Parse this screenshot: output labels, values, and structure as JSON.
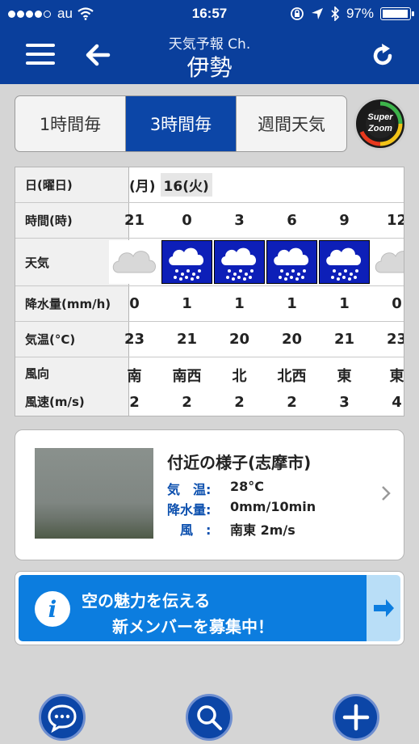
{
  "status_bar": {
    "carrier": "au",
    "time": "16:57",
    "battery": "97%",
    "battery_level": 0.97
  },
  "nav": {
    "subtitle": "天気予報 Ch.",
    "title": "伊勢"
  },
  "tabs": [
    {
      "label": "1時間毎",
      "active": false
    },
    {
      "label": "3時間毎",
      "active": true
    },
    {
      "label": "週間天気",
      "active": false
    }
  ],
  "superzoom": {
    "line1": "Super",
    "line2": "Zoom"
  },
  "forecast": {
    "labels": {
      "date": "日(曜日)",
      "time": "時間(時)",
      "weather": "天気",
      "precip": "降水量(mm/h)",
      "temp": "気温(°C)",
      "wind_dir": "風向",
      "wind_speed": "風速(m/s)"
    },
    "date_prev": "(月)",
    "date_current": "16(火)",
    "columns": [
      {
        "time": "21",
        "weather": "cloudy",
        "precip": "0",
        "temp": "23",
        "wind_dir": "南",
        "wind_speed": "2"
      },
      {
        "time": "0",
        "weather": "rain",
        "precip": "1",
        "temp": "21",
        "wind_dir": "南西",
        "wind_speed": "2"
      },
      {
        "time": "3",
        "weather": "rain",
        "precip": "1",
        "temp": "20",
        "wind_dir": "北",
        "wind_speed": "2"
      },
      {
        "time": "6",
        "weather": "rain",
        "precip": "1",
        "temp": "20",
        "wind_dir": "北西",
        "wind_speed": "2"
      },
      {
        "time": "9",
        "weather": "rain",
        "precip": "1",
        "temp": "21",
        "wind_dir": "東",
        "wind_speed": "3"
      },
      {
        "time": "12",
        "weather": "cloudy",
        "precip": "0",
        "temp": "23",
        "wind_dir": "東",
        "wind_speed": "4"
      }
    ]
  },
  "nearby": {
    "title": "付近の様子(志摩市)",
    "temp_label": "気　温:",
    "temp_value": "28°C",
    "precip_label": "降水量:",
    "precip_value": "0mm/10min",
    "wind_label": "　風　:",
    "wind_value": "南東 2m/s"
  },
  "banner": {
    "line1": "空の魅力を伝える",
    "line2": "新メンバーを募集中！"
  },
  "bottom_buttons": [
    "chat",
    "search",
    "add"
  ]
}
